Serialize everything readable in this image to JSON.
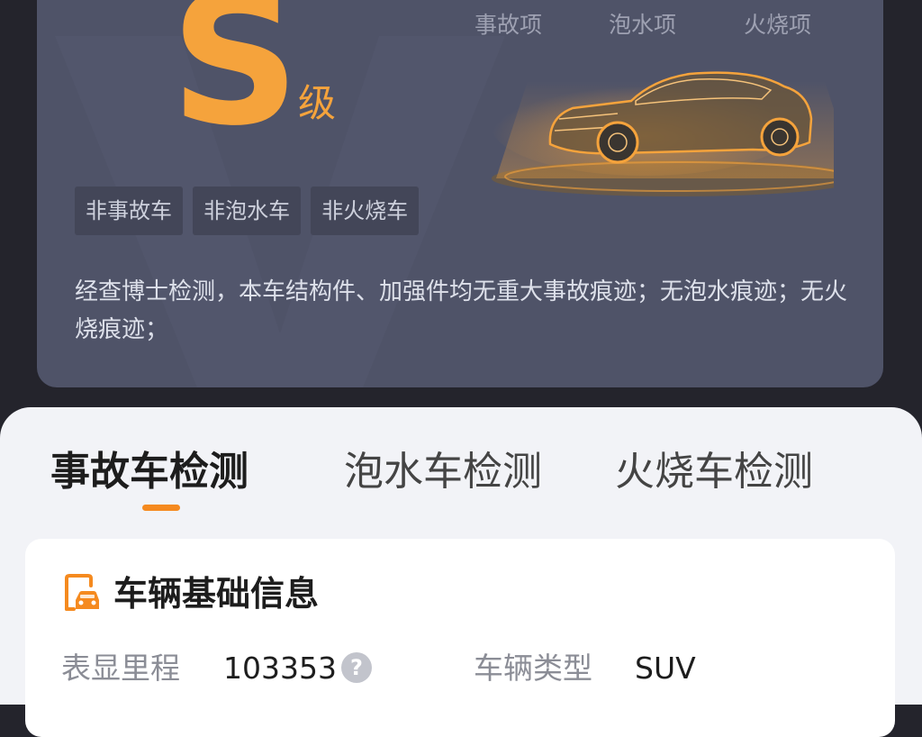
{
  "report": {
    "grade_letter": "S",
    "grade_suffix": "级",
    "check_items": [
      "事故项",
      "泡水项",
      "火烧项"
    ],
    "tags": [
      "非事故车",
      "非泡水车",
      "非火烧车"
    ],
    "description": "经查博士检测，本车结构件、加强件均无重大事故痕迹；无泡水痕迹；无火烧痕迹；"
  },
  "tabs": [
    {
      "label": "事故车检测",
      "active": true
    },
    {
      "label": "泡水车检测",
      "active": false
    },
    {
      "label": "火烧车检测",
      "active": false
    }
  ],
  "basic_info": {
    "title": "车辆基础信息",
    "fields": [
      {
        "label": "表显里程",
        "value": "103353",
        "has_help": true
      },
      {
        "label": "车辆类型",
        "value": "SUV",
        "has_help": false
      }
    ]
  },
  "colors": {
    "accent": "#f58a1f",
    "grade": "#f5a33c",
    "card_bg": "#4f5368",
    "page_bg": "#24242c",
    "icon_name": "car-document-icon"
  }
}
